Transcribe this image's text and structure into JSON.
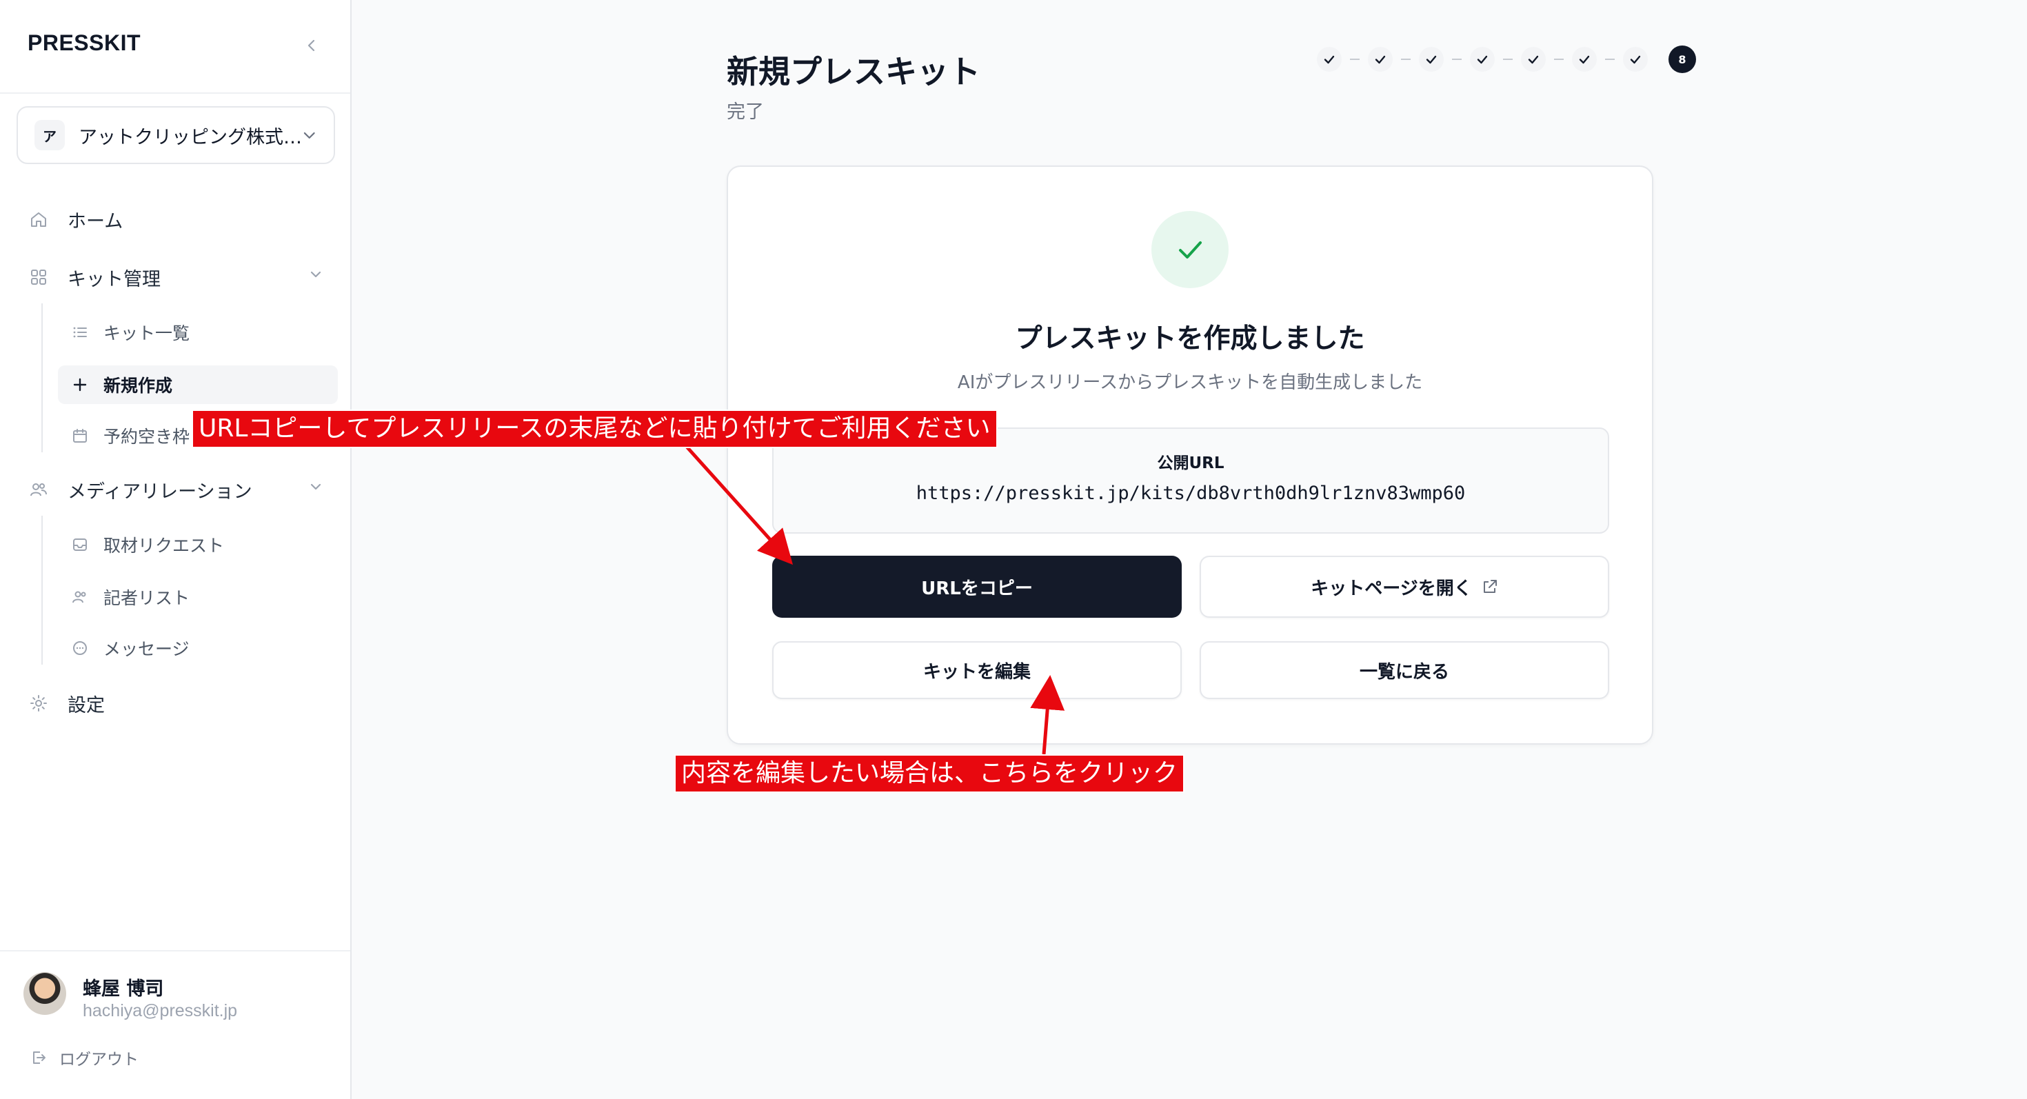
{
  "sidebar": {
    "brand": "PRESSKIT",
    "org": {
      "initial": "ア",
      "name": "アットクリッピング株式…"
    },
    "nav": {
      "home": "ホーム",
      "kit_management": "キット管理",
      "kit_list": "キット一覧",
      "new_create": "新規作成",
      "reservation": "予約空き枠",
      "media_relations": "メディアリレーション",
      "interview_requests": "取材リクエスト",
      "journalist_list": "記者リスト",
      "messages": "メッセージ",
      "settings": "設定"
    },
    "user": {
      "name": "蜂屋 博司",
      "email": "hachiya@presskit.jp"
    },
    "logout": "ログアウト"
  },
  "header": {
    "title": "新規プレスキット",
    "subtitle": "完了",
    "stepper": {
      "completed_steps": 7,
      "current_step": "8"
    }
  },
  "card": {
    "title": "プレスキットを作成しました",
    "description": "AIがプレスリリースからプレスキットを自動生成しました",
    "url_label": "公開URL",
    "url_value": "https://presskit.jp/kits/db8vrth0dh9lr1znv83wmp60",
    "copy_button": "URLをコピー",
    "open_button": "キットページを開く",
    "edit_button": "キットを編集",
    "back_button": "一覧に戻る"
  },
  "annotations": {
    "copy_note": "URLコピーしてプレスリリースの末尾などに貼り付けてご利用ください",
    "edit_note": "内容を編集したい場合は、こちらをクリック"
  },
  "colors": {
    "primary_button": "#141a29",
    "success": "#16a34a",
    "annotation": "#e8080f"
  }
}
